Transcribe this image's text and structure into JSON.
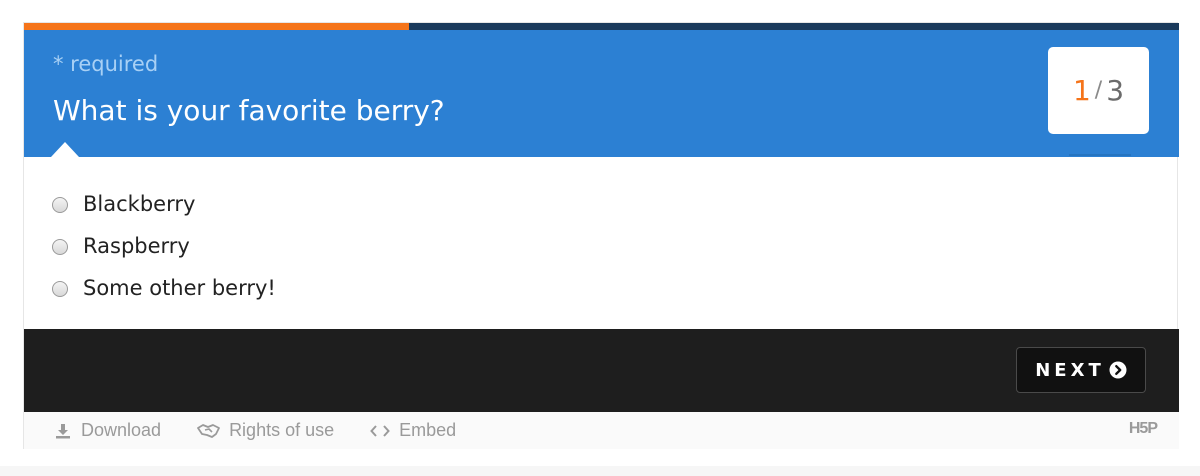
{
  "progress": {
    "fraction": 0.333
  },
  "question": {
    "required_label": "* required",
    "title": "What is your favorite berry?"
  },
  "counter": {
    "current": "1",
    "separator": "/",
    "total": "3"
  },
  "options": [
    {
      "label": "Blackberry"
    },
    {
      "label": "Raspberry"
    },
    {
      "label": "Some other berry!"
    }
  ],
  "navigation": {
    "next_label": "NEXT"
  },
  "actions": {
    "download_label": "Download",
    "rights_label": "Rights of use",
    "embed_label": "Embed",
    "logo": "H5P"
  },
  "colors": {
    "header": "#2c80d3",
    "progress_fill": "#f5741a",
    "progress_track": "#1a3a5c",
    "footer": "#1e1e1e"
  },
  "icons": {
    "next": "chevron-circle-right-icon",
    "download": "download-icon",
    "rights": "handshake-icon",
    "embed": "code-icon"
  }
}
